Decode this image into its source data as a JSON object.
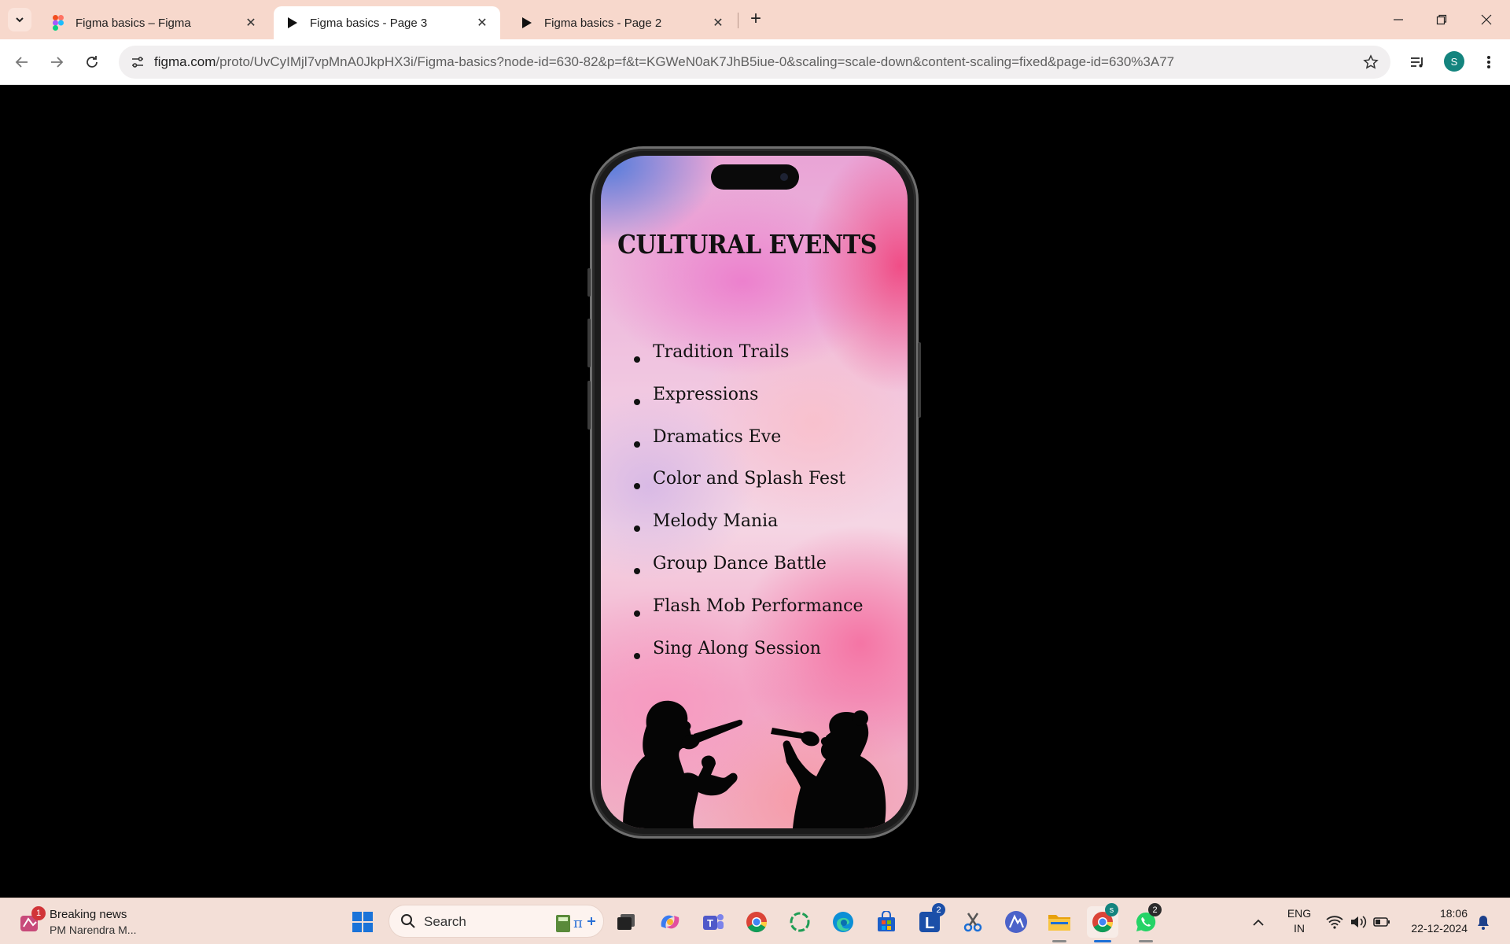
{
  "browser": {
    "tabs": [
      {
        "title": "Figma basics – Figma",
        "favicon": "figma-icon",
        "active": false
      },
      {
        "title": "Figma basics - Page 3",
        "favicon": "play-icon",
        "active": true
      },
      {
        "title": "Figma basics - Page 2",
        "favicon": "play-icon",
        "active": false
      }
    ],
    "url_host": "figma.com",
    "url_rest": "/proto/UvCyIMjl7vpMnA0JkpHX3i/Figma-basics?node-id=630-82&p=f&t=KGWeN0aK7JhB5iue-0&scaling=scale-down&content-scaling=fixed&page-id=630%3A77",
    "profile_initial": "S"
  },
  "prototype": {
    "title": "CULTURAL EVENTS",
    "events": [
      "Tradition Trails",
      "Expressions",
      "Dramatics Eve",
      "Color and Splash Fest",
      "Melody Mania",
      "Group Dance Battle",
      "Flash Mob Performance",
      "Sing Along Session"
    ]
  },
  "taskbar": {
    "news_badge": "1",
    "news_title": "Breaking news",
    "news_subtitle": "PM Narendra M...",
    "search_label": "Search",
    "l_app_badge": "2",
    "whatsapp_badge": "2",
    "chrome_profile": "s",
    "language_top": "ENG",
    "language_bottom": "IN",
    "time": "18:06",
    "date": "22-12-2024"
  },
  "colors": {
    "tabstrip": "#f7d8cc",
    "taskbar": "#f3dfd7",
    "avatar": "#14847e"
  }
}
